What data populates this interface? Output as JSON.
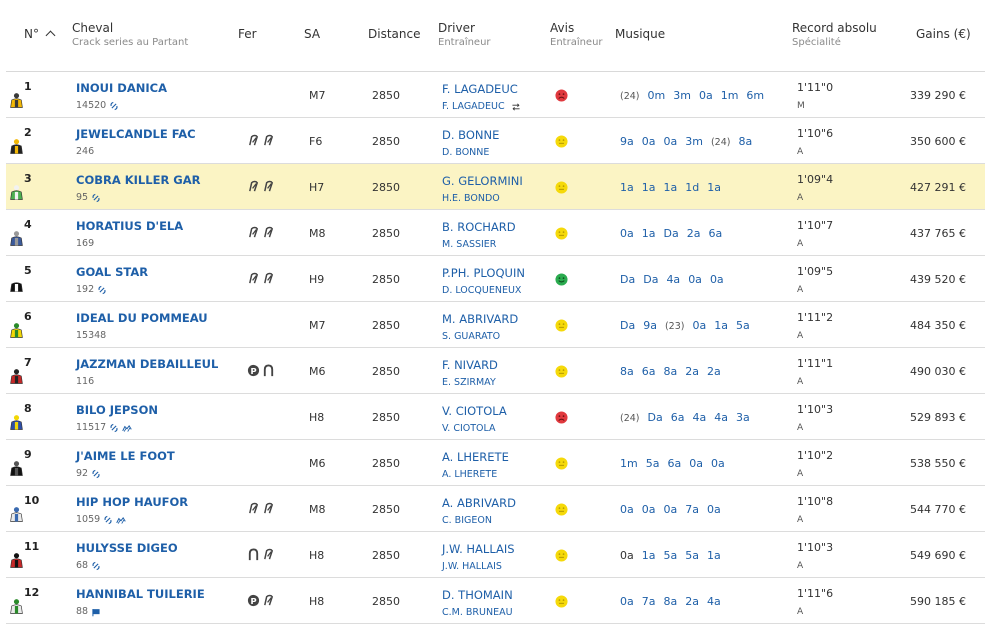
{
  "header": {
    "num": "N°",
    "cheval": "Cheval",
    "cheval_sub": "Crack series au Partant",
    "fer": "Fer",
    "sa": "SA",
    "distance": "Distance",
    "driver": "Driver",
    "driver_sub": "Entraîneur",
    "avis": "Avis",
    "avis_sub": "Entraîneur",
    "musique": "Musique",
    "record": "Record absolu",
    "record_sub": "Spécialité",
    "gains": "Gains (€)"
  },
  "colors": {
    "link": "#1e5fa8",
    "highlight": "#fbf4c4",
    "good": "#2bab4f",
    "neutral": "#f5d90a",
    "bad": "#e0393e"
  },
  "rows": [
    {
      "num": "1",
      "name": "INOUI DANICA",
      "sub": "14520",
      "sub_icons": [
        "gear-icon"
      ],
      "fer": [],
      "sa": "M7",
      "dist": "2850",
      "driver": "F. LAGADEUC",
      "trainer": "F. LAGADEUC",
      "swap": true,
      "avis": "bad",
      "musique": [
        {
          "t": "(24)",
          "k": "yr"
        },
        {
          "t": "0m"
        },
        {
          "t": "3m"
        },
        {
          "t": "0a"
        },
        {
          "t": "1m"
        },
        {
          "t": "6m"
        }
      ],
      "record": "1'11\"0",
      "spec": "M",
      "gains": "339 290 €",
      "silk": [
        "#f2b705",
        "#3a3a3a"
      ]
    },
    {
      "num": "2",
      "name": "JEWELCANDLE FAC",
      "sub": "246",
      "sub_icons": [],
      "fer": [
        "d4",
        "d4"
      ],
      "sa": "F6",
      "dist": "2850",
      "driver": "D. BONNE",
      "trainer": "D. BONNE",
      "avis": "neutral",
      "musique": [
        {
          "t": "9a"
        },
        {
          "t": "0a"
        },
        {
          "t": "0a"
        },
        {
          "t": "3m"
        },
        {
          "t": "(24)",
          "k": "yr"
        },
        {
          "t": "8a"
        }
      ],
      "record": "1'10\"6",
      "spec": "A",
      "gains": "350 600 €",
      "silk": [
        "#222",
        "#f2b705"
      ]
    },
    {
      "num": "3",
      "name": "COBRA KILLER GAR",
      "sub": "95",
      "sub_icons": [
        "gear-icon"
      ],
      "fer": [
        "d4",
        "d4"
      ],
      "sa": "H7",
      "dist": "2850",
      "driver": "G. GELORMINI",
      "trainer": "H.E. BONDO",
      "avis": "neutral",
      "musique": [
        {
          "t": "1a"
        },
        {
          "t": "1a"
        },
        {
          "t": "1a"
        },
        {
          "t": "1d"
        },
        {
          "t": "1a"
        }
      ],
      "record": "1'09\"4",
      "spec": "A",
      "gains": "427 291 €",
      "silk": [
        "#4caf50",
        "#f2f2f2"
      ],
      "hl": true
    },
    {
      "num": "4",
      "name": "HORATIUS D'ELA",
      "sub": "169",
      "sub_icons": [],
      "fer": [
        "d4",
        "d4"
      ],
      "sa": "M8",
      "dist": "2850",
      "driver": "B. ROCHARD",
      "trainer": "M. SASSIER",
      "avis": "neutral",
      "musique": [
        {
          "t": "0a"
        },
        {
          "t": "1a"
        },
        {
          "t": "Da"
        },
        {
          "t": "2a"
        },
        {
          "t": "6a"
        }
      ],
      "record": "1'10\"7",
      "spec": "A",
      "gains": "437 765 €",
      "silk": [
        "#3b5a9a",
        "#999"
      ]
    },
    {
      "num": "5",
      "name": "GOAL STAR",
      "sub": "192",
      "sub_icons": [
        "gear-icon"
      ],
      "fer": [
        "d4",
        "d4"
      ],
      "sa": "H9",
      "dist": "2850",
      "driver": "P.PH. PLOQUIN",
      "trainer": "D. LOCQUENEUX",
      "avis": "good",
      "musique": [
        {
          "t": "Da"
        },
        {
          "t": "Da"
        },
        {
          "t": "4a"
        },
        {
          "t": "0a"
        },
        {
          "t": "0a"
        }
      ],
      "record": "1'09\"5",
      "spec": "A",
      "gains": "439 520 €",
      "silk": [
        "#111",
        "#fff"
      ]
    },
    {
      "num": "6",
      "name": "IDEAL DU POMMEAU",
      "sub": "15348",
      "sub_icons": [],
      "fer": [],
      "sa": "M7",
      "dist": "2850",
      "driver": "M. ABRIVARD",
      "trainer": "S. GUARATO",
      "avis": "neutral",
      "musique": [
        {
          "t": "Da"
        },
        {
          "t": "9a"
        },
        {
          "t": "(23)",
          "k": "yr"
        },
        {
          "t": "0a"
        },
        {
          "t": "1a"
        },
        {
          "t": "5a"
        }
      ],
      "record": "1'11\"2",
      "spec": "A",
      "gains": "484 350 €",
      "silk": [
        "#f2d705",
        "#2a8a2a"
      ]
    },
    {
      "num": "7",
      "name": "JAZZMAN DEBAILLEUL",
      "sub": "116",
      "sub_icons": [],
      "fer": [
        "p",
        "shoe"
      ],
      "sa": "M6",
      "dist": "2850",
      "driver": "F. NIVARD",
      "trainer": "E. SZIRMAY",
      "avis": "neutral",
      "musique": [
        {
          "t": "8a"
        },
        {
          "t": "6a"
        },
        {
          "t": "8a"
        },
        {
          "t": "2a"
        },
        {
          "t": "2a"
        }
      ],
      "record": "1'11\"1",
      "spec": "A",
      "gains": "490 030 €",
      "silk": [
        "#c62828",
        "#222"
      ]
    },
    {
      "num": "8",
      "name": "BILO JEPSON",
      "sub": "11517",
      "sub_icons": [
        "gear-icon",
        "horses-icon"
      ],
      "fer": [],
      "sa": "H8",
      "dist": "2850",
      "driver": "V. CIOTOLA",
      "trainer": "V. CIOTOLA",
      "avis": "bad",
      "musique": [
        {
          "t": "(24)",
          "k": "yr"
        },
        {
          "t": "Da"
        },
        {
          "t": "6a"
        },
        {
          "t": "4a"
        },
        {
          "t": "4a"
        },
        {
          "t": "3a"
        }
      ],
      "record": "1'10\"3",
      "spec": "A",
      "gains": "529 893 €",
      "silk": [
        "#2e4fa8",
        "#f2d705"
      ]
    },
    {
      "num": "9",
      "name": "J'AIME LE FOOT",
      "sub": "92",
      "sub_icons": [
        "gear-icon"
      ],
      "fer": [],
      "sa": "M6",
      "dist": "2850",
      "driver": "A. LHERETE",
      "trainer": "A. LHERETE",
      "avis": "neutral",
      "musique": [
        {
          "t": "1m"
        },
        {
          "t": "5a"
        },
        {
          "t": "6a"
        },
        {
          "t": "0a"
        },
        {
          "t": "0a"
        }
      ],
      "record": "1'10\"2",
      "spec": "A",
      "gains": "538 550 €",
      "silk": [
        "#111",
        "#555"
      ]
    },
    {
      "num": "10",
      "name": "HIP HOP HAUFOR",
      "sub": "1059",
      "sub_icons": [
        "gear-icon",
        "horses-icon"
      ],
      "fer": [
        "d4",
        "d4"
      ],
      "sa": "M8",
      "dist": "2850",
      "driver": "A. ABRIVARD",
      "trainer": "C. BIGEON",
      "avis": "neutral",
      "musique": [
        {
          "t": "0a"
        },
        {
          "t": "0a"
        },
        {
          "t": "0a"
        },
        {
          "t": "7a"
        },
        {
          "t": "0a"
        }
      ],
      "record": "1'10\"8",
      "spec": "A",
      "gains": "544 770 €",
      "silk": [
        "#eaeaea",
        "#3a6ab0"
      ]
    },
    {
      "num": "11",
      "name": "HULYSSE DIGEO",
      "sub": "68",
      "sub_icons": [
        "gear-icon"
      ],
      "fer": [
        "shoe",
        "d4"
      ],
      "sa": "H8",
      "dist": "2850",
      "driver": "J.W. HALLAIS",
      "trainer": "J.W. HALLAIS",
      "avis": "neutral",
      "musique": [
        {
          "t": "0a",
          "k": "plain"
        },
        {
          "t": "1a"
        },
        {
          "t": "5a"
        },
        {
          "t": "5a"
        },
        {
          "t": "1a"
        }
      ],
      "record": "1'10\"3",
      "spec": "A",
      "gains": "549 690 €",
      "silk": [
        "#c62828",
        "#111"
      ]
    },
    {
      "num": "12",
      "name": "HANNIBAL TUILERIE",
      "sub": "88",
      "sub_icons": [
        "flag-icon"
      ],
      "fer": [
        "p",
        "d4"
      ],
      "sa": "H8",
      "dist": "2850",
      "driver": "D. THOMAIN",
      "trainer": "C.M. BRUNEAU",
      "avis": "neutral",
      "musique": [
        {
          "t": "0a"
        },
        {
          "t": "7a"
        },
        {
          "t": "8a"
        },
        {
          "t": "2a"
        },
        {
          "t": "4a"
        }
      ],
      "record": "1'11\"6",
      "spec": "A",
      "gains": "590 185 €",
      "silk": [
        "#eaeaea",
        "#2a8a2a"
      ]
    }
  ]
}
